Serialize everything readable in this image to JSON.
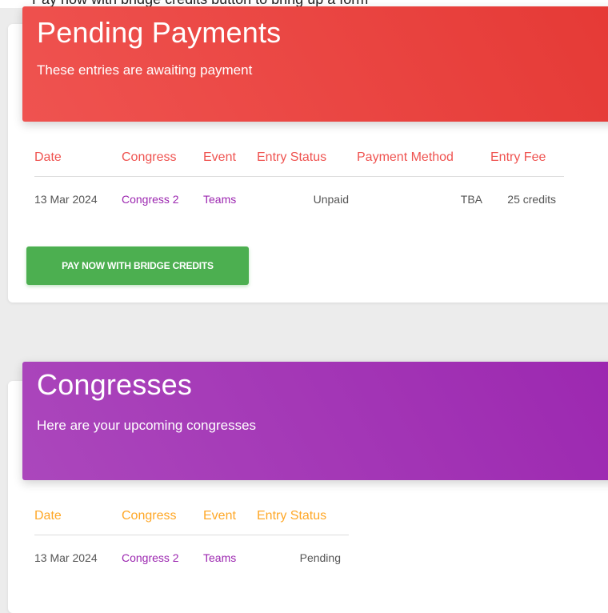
{
  "top_text": "Pay now with bridge credits button to bring up a form",
  "pending_payments": {
    "title": "Pending Payments",
    "subtitle": "These entries are awaiting payment",
    "columns": [
      "Date",
      "Congress",
      "Event",
      "Entry Status",
      "Payment Method",
      "Entry Fee"
    ],
    "rows": [
      {
        "date": "13 Mar 2024",
        "congress": "Congress 2",
        "event": "Teams",
        "entry_status": "Unpaid",
        "payment_method": "TBA",
        "entry_fee": "25 credits"
      }
    ],
    "pay_button_label": "PAY NOW WITH BRIDGE CREDITS",
    "colors": {
      "header": "#ef5350",
      "column_headers": "#ef5350",
      "button": "#4caf50"
    }
  },
  "congresses": {
    "title": "Congresses",
    "subtitle": "Here are your upcoming congresses",
    "columns": [
      "Date",
      "Congress",
      "Event",
      "Entry Status"
    ],
    "rows": [
      {
        "date": "13 Mar 2024",
        "congress": "Congress 2",
        "event": "Teams",
        "entry_status": "Pending"
      }
    ],
    "colors": {
      "header": "#ab47bc",
      "column_headers": "#ffa726"
    }
  },
  "link_color": "#9c27b0"
}
